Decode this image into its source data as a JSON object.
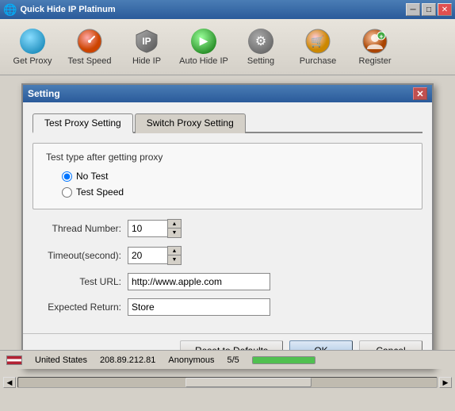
{
  "app": {
    "title": "Quick Hide IP Platinum",
    "icon": "🌐"
  },
  "titlebar": {
    "minimize_label": "─",
    "maximize_label": "□",
    "close_label": "✕"
  },
  "toolbar": {
    "buttons": [
      {
        "id": "get-proxy",
        "label": "Get Proxy",
        "icon": "globe"
      },
      {
        "id": "test-speed",
        "label": "Test Speed",
        "icon": "speed"
      },
      {
        "id": "hide-ip",
        "label": "Hide IP",
        "icon": "shield"
      },
      {
        "id": "auto-hide-ip",
        "label": "Auto Hide IP",
        "icon": "play"
      },
      {
        "id": "setting",
        "label": "Setting",
        "icon": "gear"
      },
      {
        "id": "purchase",
        "label": "Purchase",
        "icon": "cart"
      },
      {
        "id": "register",
        "label": "Register",
        "icon": "person"
      }
    ]
  },
  "dialog": {
    "title": "Setting",
    "close_label": "✕",
    "tabs": [
      {
        "id": "test-proxy",
        "label": "Test Proxy Setting",
        "active": true
      },
      {
        "id": "switch-proxy",
        "label": "Switch Proxy Setting",
        "active": false
      }
    ],
    "section_title": "Test type after getting proxy",
    "radio_options": [
      {
        "id": "no-test",
        "label": "No Test",
        "checked": true
      },
      {
        "id": "test-speed",
        "label": "Test Speed",
        "checked": false
      }
    ],
    "fields": [
      {
        "id": "thread-number",
        "label": "Thread Number:",
        "value": "10",
        "type": "spin"
      },
      {
        "id": "timeout",
        "label": "Timeout(second):",
        "value": "20",
        "type": "spin"
      },
      {
        "id": "test-url",
        "label": "Test URL:",
        "value": "http://www.apple.com",
        "type": "text"
      },
      {
        "id": "expected-return",
        "label": "Expected Return:",
        "value": "Store",
        "type": "text"
      }
    ],
    "buttons": {
      "reset": "Reset to Defaults",
      "ok": "OK",
      "cancel": "Cancel"
    }
  },
  "statusbar": {
    "country": "United States",
    "ip": "208.89.212.81",
    "type": "Anonymous",
    "count": "5/5",
    "progress": 100
  },
  "branding": {
    "text": "Quick"
  }
}
